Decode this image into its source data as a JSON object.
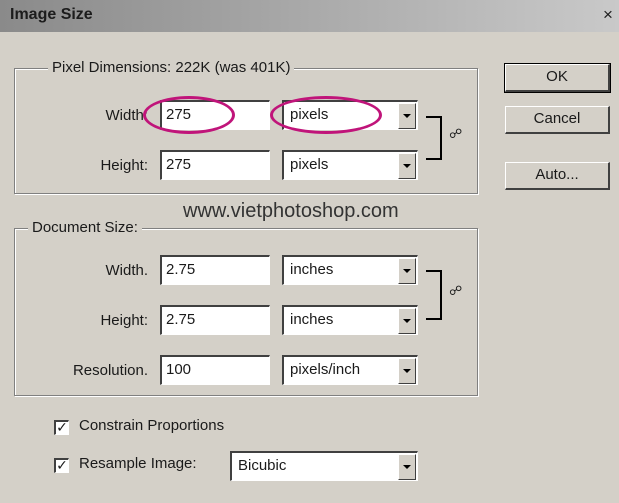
{
  "window": {
    "title": "Image Size",
    "close_glyph": "×"
  },
  "pixel_dimensions": {
    "legend": "Pixel Dimensions:  222K (was 401K)",
    "width_label": "Width:",
    "width_value": "275",
    "width_unit": "pixels",
    "height_label": "Height:",
    "height_value": "275",
    "height_unit": "pixels"
  },
  "document_size": {
    "legend": "Document Size:",
    "width_label": "Width.",
    "width_value": "2.75",
    "width_unit": "inches",
    "height_label": "Height:",
    "height_value": "2.75",
    "height_unit": "inches",
    "resolution_label": "Resolution.",
    "resolution_value": "100",
    "resolution_unit": "pixels/inch"
  },
  "buttons": {
    "ok": "OK",
    "cancel": "Cancel",
    "auto": "Auto..."
  },
  "options": {
    "constrain_label": "Constrain Proportions",
    "constrain_checked": true,
    "resample_label": "Resample Image:",
    "resample_checked": true,
    "resample_method": "Bicubic"
  },
  "watermark": "www.vietphotoshop.com",
  "icons": {
    "link": "chain-link-icon",
    "dropdown": "chevron-down-icon",
    "check": "checkmark-icon"
  },
  "colors": {
    "dialog_bg": "#d4d0c8",
    "highlight": "#c0147a"
  }
}
